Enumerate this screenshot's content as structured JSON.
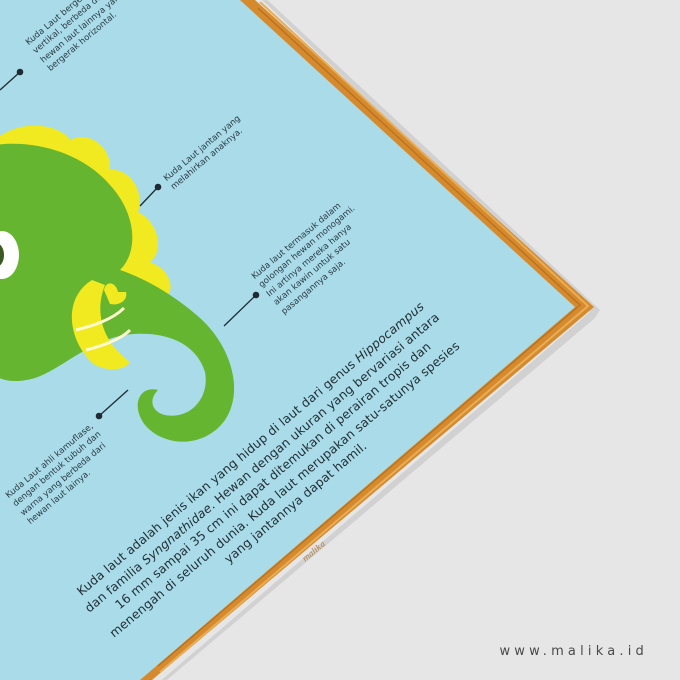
{
  "colors": {
    "background": "#e6e6e6",
    "poster": "#a9dce8",
    "frame": "#d58a2e",
    "seahorse_green": "#66b530",
    "mane_yellow": "#f1ea21",
    "text": "#222e36"
  },
  "facts": {
    "vertical": [
      "Kuda Laut bergerak",
      "vertikal, berbeda dengan",
      "hewan laut lainnya yang",
      "bergerak horizontal."
    ],
    "male_birth": [
      "Kuda Laut jantan yang",
      "melahirkan anaknya."
    ],
    "monogamy": [
      "Kuda laut termasuk dalam",
      "golongan hewan monogami.",
      "Ini artinya mereka hanya",
      "akan kawin untuk satu",
      "pasangannya saja."
    ],
    "camouflage": [
      "Kuda Laut ahli kamuflase,",
      "dengan bentuk tubuh dan",
      "warna yang berbeda dari",
      "hewan laut lainya."
    ]
  },
  "paragraph": {
    "line1": "Kuda laut adalah jenis ikan yang hidup di laut dari genus ",
    "line1_italic": "Hippocampus",
    "line2_a": "dan familia ",
    "line2_italic": "Syngnathidae",
    "line2_b": ". Hewan dengan ukuran yang bervariasi antara",
    "line3": "16 mm sampai 35 cm ini dapat ditemukan di perairan tropis dan",
    "line4": "menengah di seluruh dunia. Kuda laut merupakan satu-satunya spesies",
    "line5": "yang jantannya dapat hamil."
  },
  "signature": "malika",
  "website": "www.malika.id"
}
